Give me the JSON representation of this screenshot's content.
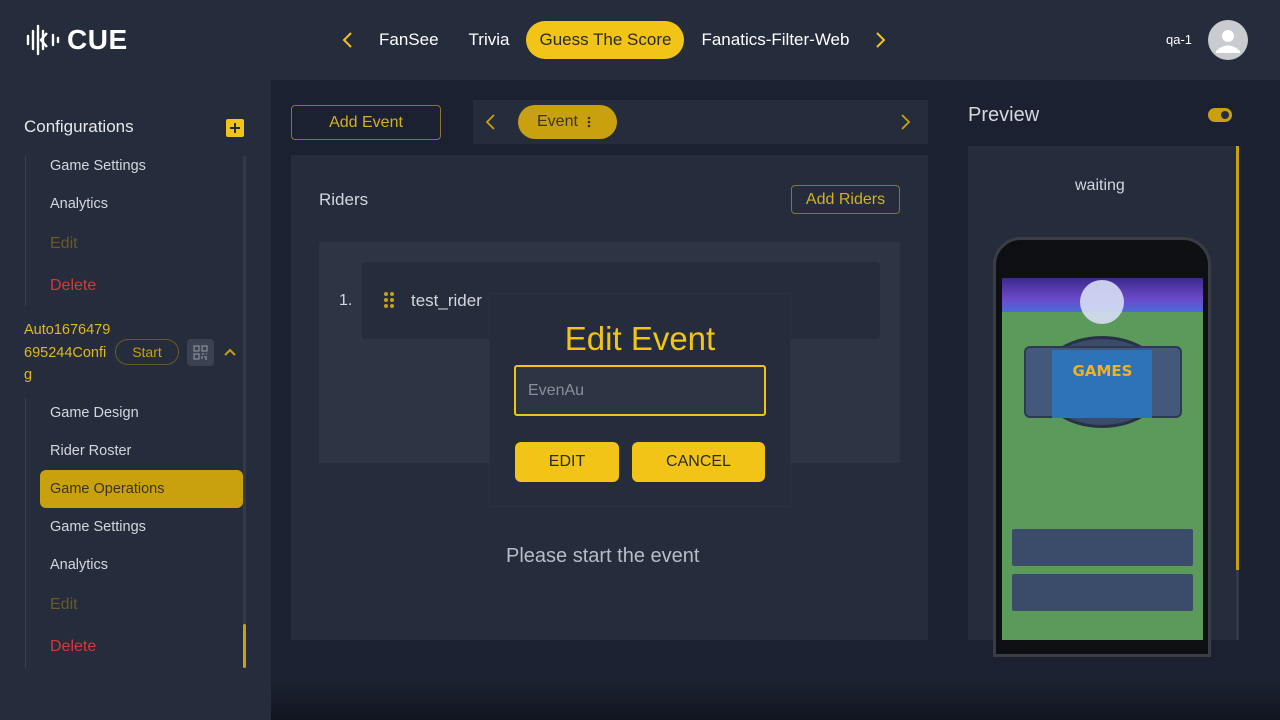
{
  "header": {
    "logo_text": "CUE",
    "tabs": [
      {
        "label": "FanSee"
      },
      {
        "label": "Trivia"
      },
      {
        "label": "Guess The Score"
      },
      {
        "label": "Fanatics-Filter-Web"
      }
    ],
    "active_tab": "Guess The Score",
    "user_name": "qa-1"
  },
  "sidebar": {
    "title": "Configurations",
    "group1_items": [
      {
        "label": "Game Settings"
      },
      {
        "label": "Analytics"
      },
      {
        "label": "Edit"
      },
      {
        "label": "Delete"
      }
    ],
    "config_name": "Auto1676479695244Config",
    "start_label": "Start",
    "group2_items": [
      {
        "label": "Game Design"
      },
      {
        "label": "Rider Roster"
      },
      {
        "label": "Game Operations"
      },
      {
        "label": "Game Settings"
      },
      {
        "label": "Analytics"
      },
      {
        "label": "Edit"
      },
      {
        "label": "Delete"
      }
    ],
    "active_item": "Game Operations"
  },
  "main": {
    "add_event_label": "Add Event",
    "event_chip_label": "Event",
    "riders_label": "Riders",
    "add_riders_label": "Add Riders",
    "rider_number": "1.",
    "rider_name": "test_rider",
    "status_message": "Please start the event"
  },
  "preview": {
    "title": "Preview",
    "toggle_on": true,
    "status": "waiting",
    "screen_title": "GAMES"
  },
  "modal": {
    "title": "Edit Event",
    "input_value": "EvenAu",
    "edit_label": "EDIT",
    "cancel_label": "CANCEL"
  },
  "colors": {
    "accent": "#f2c417",
    "background": "#1b2130",
    "panel": "#252c3b",
    "danger": "#d9363e"
  }
}
